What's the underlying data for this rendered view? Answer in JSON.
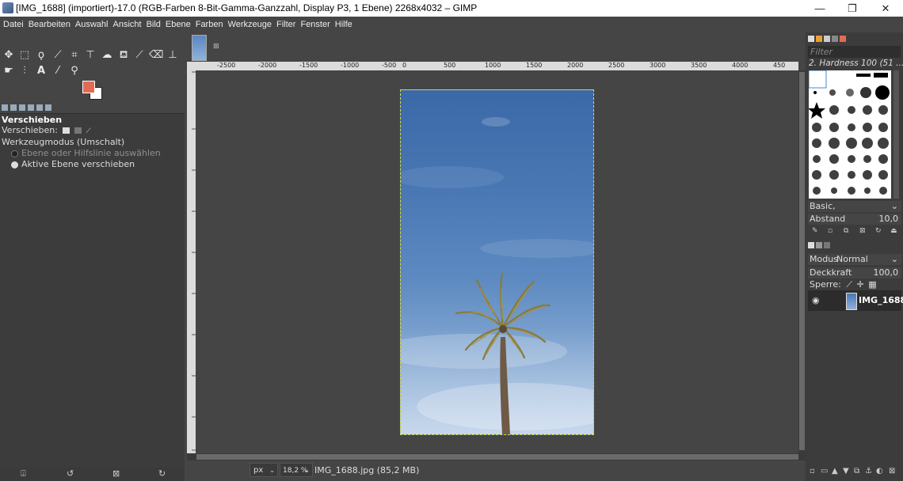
{
  "window": {
    "title": "[IMG_1688] (importiert)-17.0 (RGB-Farben 8-Bit-Gamma-Ganzzahl, Display P3, 1 Ebene) 2268x4032 – GIMP",
    "minimize": "—",
    "maximize": "❐",
    "close": "✕"
  },
  "menu": [
    "Datei",
    "Bearbeiten",
    "Auswahl",
    "Ansicht",
    "Bild",
    "Ebene",
    "Farben",
    "Werkzeuge",
    "Filter",
    "Fenster",
    "Hilfe"
  ],
  "toolbox": {
    "tools_row1": [
      "move",
      "rect-select",
      "free-select",
      "fuzzy-select",
      "crop",
      "unified-transform",
      "warp",
      "bucket-fill",
      "paintbrush",
      "eraser",
      "clone"
    ],
    "tools_row2": [
      "smudge",
      "paths",
      "text",
      "color-picker",
      "zoom"
    ],
    "fg_color": "#e46a52",
    "bg_color": "#ffffff"
  },
  "tool_options": {
    "title": "Verschieben",
    "move_label": "Verschieben:",
    "mode_label": "Werkzeugmodus (Umschalt)",
    "options": [
      {
        "label": "Ebene oder Hilfslinie auswählen",
        "selected": false
      },
      {
        "label": "Aktive Ebene verschieben",
        "selected": true
      }
    ]
  },
  "ruler": {
    "top_ticks": [
      "-2500",
      "-2000",
      "-1500",
      "-1000",
      "-500",
      "0",
      "500",
      "1000",
      "1500",
      "2000",
      "2500",
      "3000",
      "3500",
      "4000",
      "450"
    ],
    "left_ticks": [
      "-500",
      "0",
      "500",
      "1000",
      "1500",
      "2000",
      "2500",
      "3000",
      "3500",
      "4000"
    ]
  },
  "statusbar": {
    "unit": "px",
    "zoom": "18,2 %",
    "file": "IMG_1688.jpg (85,2 MB)"
  },
  "brushes": {
    "filter_placeholder": "Filter",
    "current": "2. Hardness 100 (51 ...",
    "preset": "Basic,",
    "spacing_label": "Abstand",
    "spacing_value": "10,0"
  },
  "layers": {
    "mode_label": "Modus",
    "mode_value": "Normal",
    "opacity_label": "Deckkraft",
    "opacity_value": "100,0",
    "lock_label": "Sperre:",
    "items": [
      {
        "name": "IMG_1688",
        "visible": true
      }
    ]
  }
}
